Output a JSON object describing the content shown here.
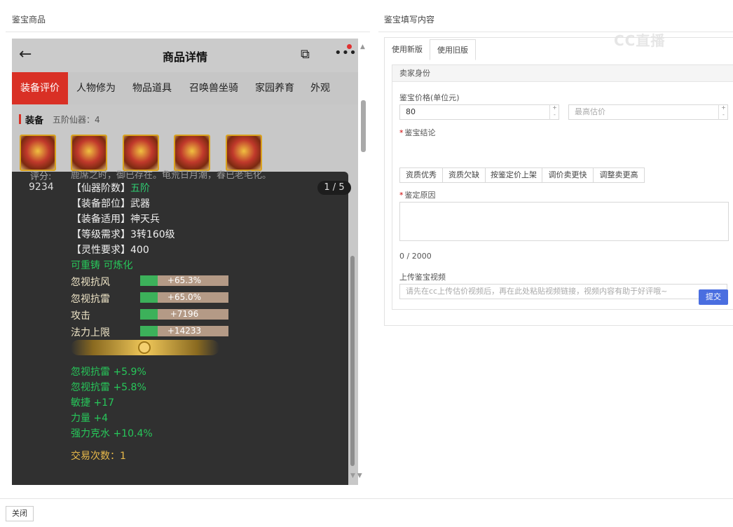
{
  "left_panel": {
    "title": "鉴宝商品"
  },
  "right_panel": {
    "title": "鉴宝填写内容"
  },
  "phone": {
    "header": {
      "title": "商品详情",
      "back": "←",
      "share": "⧉",
      "more": "•••"
    },
    "tabs": [
      "装备评价",
      "人物修为",
      "物品道具",
      "召唤兽坐骑",
      "家园养育",
      "外观"
    ],
    "equip_section": {
      "label": "装备",
      "sub": "五阶仙器：4"
    },
    "popup": {
      "score_label": "评分:",
      "score": "9234",
      "cut_text": "鹿席之时，御已存在。龟荒日月潮，春已老毛化。",
      "pager": "1 / 5",
      "attrs": [
        {
          "key": "【仙器阶数】",
          "val": "五阶",
          "hl": true
        },
        {
          "key": "【装备部位】",
          "val": "武器",
          "hl": false
        },
        {
          "key": "【装备适用】",
          "val": "神天兵",
          "hl": false
        },
        {
          "key": "【等级需求】",
          "val": "3转160级",
          "hl": false
        },
        {
          "key": "【灵性要求】",
          "val": "400",
          "hl": false
        }
      ],
      "reforge": "可重铸 可炼化",
      "stats": [
        {
          "name": "忽视抗风",
          "value": "+65.3%",
          "fill": 0.2
        },
        {
          "name": "忽视抗雷",
          "value": "+65.0%",
          "fill": 0.2
        },
        {
          "name": "攻击",
          "value": "+7196",
          "fill": 0.2
        },
        {
          "name": "法力上限",
          "value": "+14233",
          "fill": 0.2
        }
      ],
      "extras": [
        "忽视抗雷 +5.9%",
        "忽视抗雷 +5.8%",
        "敏捷 +17",
        "力量 +4",
        "强力克水 +10.4%"
      ],
      "trade_label": "交易次数：",
      "trade_count": "1"
    }
  },
  "form": {
    "tabs": [
      "使用新版",
      "使用旧版"
    ],
    "section": "卖家身份",
    "price_label": "鉴宝价格(单位元)",
    "price_value": "80",
    "max_price_placeholder": "最高估价",
    "conclusion_label": "鉴宝结论",
    "conclusions": [
      "资质优秀",
      "资质欠缺",
      "按鉴定价上架",
      "调价卖更快",
      "调整卖更高"
    ],
    "reason_label": "鉴定原因",
    "char_count": "0 / 2000",
    "video_label": "上传鉴宝视频",
    "video_placeholder": "请先在cc上传估价视频后，再在此处粘贴视频链接，视频内容有助于好评哦~",
    "submit": "提交"
  },
  "watermark": "CC直播",
  "close_label": "关闭"
}
